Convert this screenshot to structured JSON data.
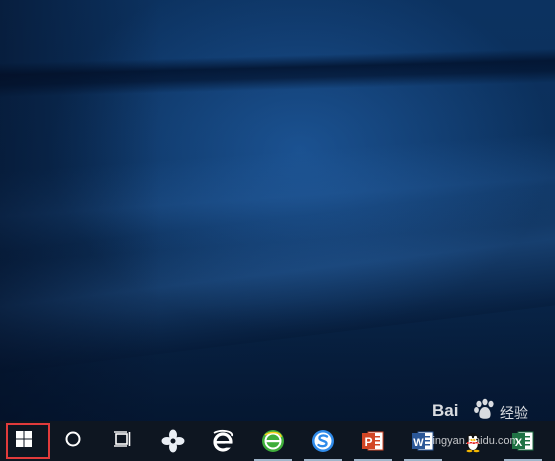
{
  "desktop": {
    "wallpaper": "windows-10-hero-blue",
    "accent_color": "#0b2f5a"
  },
  "taskbar": {
    "background_color": "#0e1621",
    "highlight_color": "#e23b3b",
    "start": {
      "icon": "windows-logo-icon",
      "highlighted": true
    },
    "search": {
      "icon": "cortana-circle-icon"
    },
    "task_view": {
      "icon": "task-view-icon"
    },
    "pinned_apps": [
      {
        "icon": "pinwheel-app-icon"
      },
      {
        "icon": "internet-explorer-icon"
      },
      {
        "icon": "360-browser-icon"
      },
      {
        "icon": "sogou-browser-icon"
      },
      {
        "icon": "powerpoint-icon",
        "letter": "P"
      },
      {
        "icon": "word-icon",
        "letter": "W"
      },
      {
        "icon": "qq-penguin-icon"
      },
      {
        "icon": "excel-icon",
        "letter": "X"
      }
    ]
  },
  "watermark": {
    "logo_text": "Bai",
    "logo_suffix": "经验",
    "url_text": "jingyan.baidu.com"
  }
}
